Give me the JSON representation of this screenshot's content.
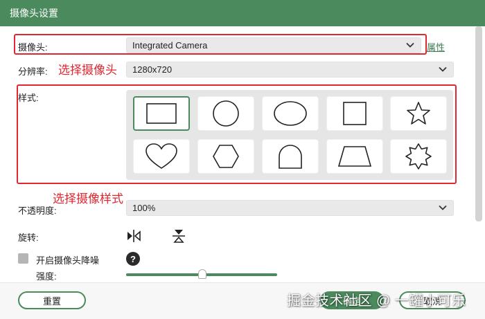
{
  "window": {
    "title": "摄像头设置"
  },
  "camera": {
    "label": "摄像头:",
    "value": "Integrated Camera",
    "properties_link": "属性"
  },
  "resolution": {
    "label": "分辨率:",
    "value": "1280x720"
  },
  "style": {
    "label": "样式:",
    "shapes": [
      "rectangle",
      "circle",
      "ellipse",
      "square",
      "star",
      "heart",
      "hexagon",
      "arch",
      "trapezoid",
      "badge"
    ],
    "selected": "rectangle"
  },
  "opacity": {
    "label": "不透明度:",
    "value": "100%"
  },
  "rotation": {
    "label": "旋转:",
    "icons": [
      "flip-horizontal-icon",
      "flip-vertical-icon"
    ]
  },
  "noise_reduction": {
    "label": "开启摄像头降噪",
    "checked": false
  },
  "strength": {
    "label": "强度:",
    "level": 0.5
  },
  "annotations": {
    "select_camera": "选择摄像头",
    "select_style": "选择摄像样式"
  },
  "footer": {
    "reset": "重置",
    "confirm": "确定",
    "cancel": "取消"
  },
  "watermark": "掘金技术社区 @ 一罐小可乐",
  "colors": {
    "brand": "#4a8a5c",
    "annotation": "#e0262f"
  }
}
